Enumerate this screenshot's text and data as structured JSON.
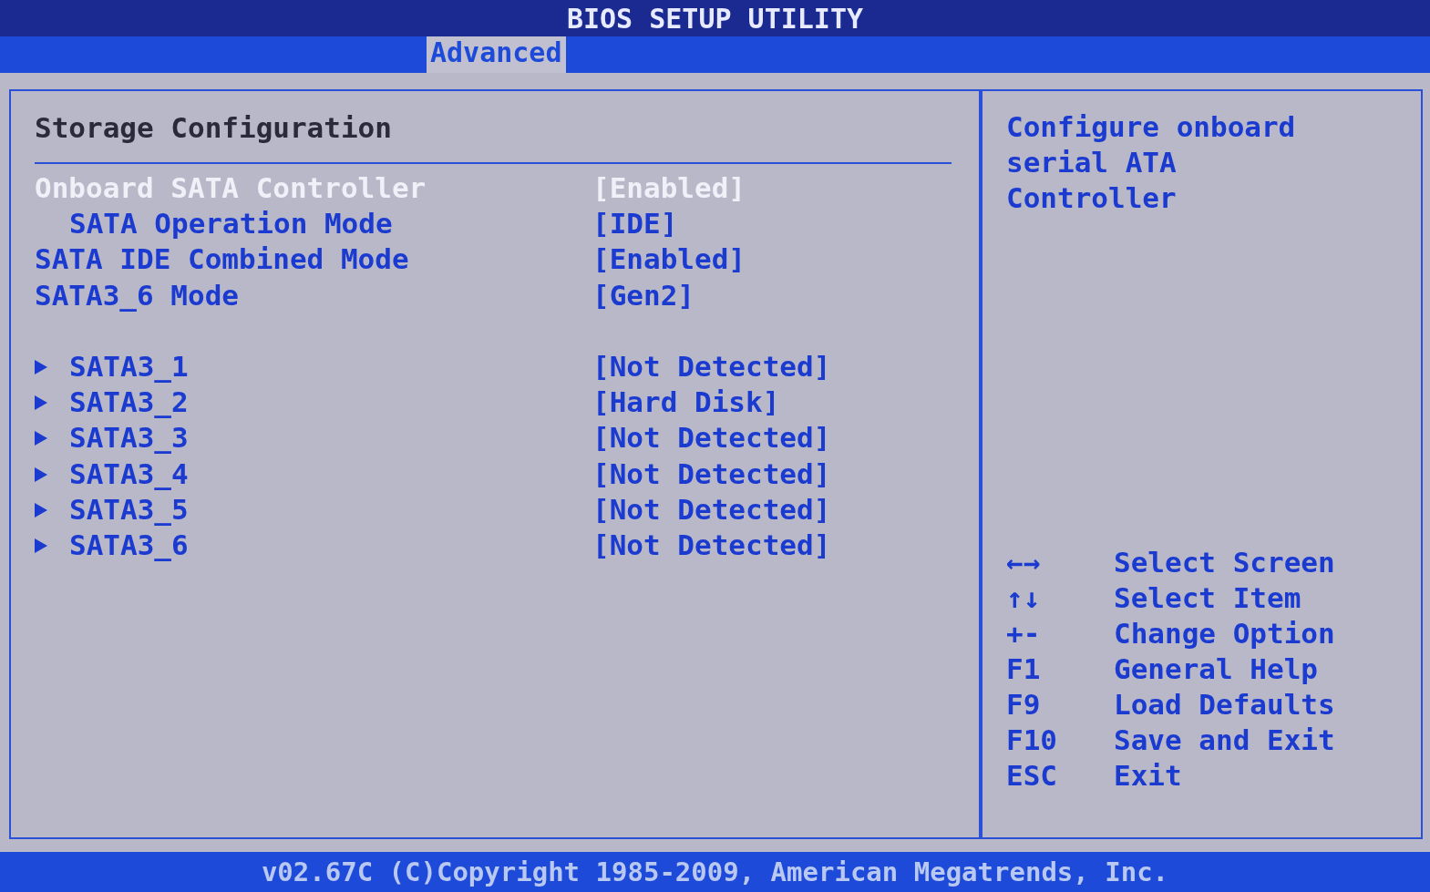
{
  "title": "BIOS SETUP UTILITY",
  "tabs": [
    {
      "label": "Advanced",
      "selected": true
    }
  ],
  "panel": {
    "title": "Storage Configuration",
    "settings": [
      {
        "label": "Onboard SATA Controller",
        "value": "[Enabled]",
        "selected": true,
        "children": [
          {
            "label": "SATA Operation Mode",
            "value": "[IDE]",
            "selected": false
          }
        ]
      },
      {
        "label": "SATA IDE Combined Mode",
        "value": "[Enabled]",
        "selected": false
      },
      {
        "label": "SATA3_6 Mode",
        "value": "[Gen2]",
        "selected": false
      }
    ],
    "devices": [
      {
        "label": "SATA3_1",
        "value": "[Not Detected]",
        "selected": false
      },
      {
        "label": "SATA3_2",
        "value": "[Hard Disk]",
        "selected": false
      },
      {
        "label": "SATA3_3",
        "value": "[Not Detected]",
        "selected": false
      },
      {
        "label": "SATA3_4",
        "value": "[Not Detected]",
        "selected": false
      },
      {
        "label": "SATA3_5",
        "value": "[Not Detected]",
        "selected": false
      },
      {
        "label": "SATA3_6",
        "value": "[Not Detected]",
        "selected": false
      }
    ]
  },
  "help": {
    "text": "Configure onboard serial ATA Controller",
    "keys": [
      {
        "key": "←→",
        "action": "Select Screen"
      },
      {
        "key": "↑↓",
        "action": "Select Item"
      },
      {
        "key": "+-",
        "action": "Change Option"
      },
      {
        "key": "F1",
        "action": "General Help"
      },
      {
        "key": "F9",
        "action": "Load Defaults"
      },
      {
        "key": "F10",
        "action": "Save and Exit"
      },
      {
        "key": "ESC",
        "action": "Exit"
      }
    ]
  },
  "footer": "v02.67C (C)Copyright 1985-2009, American Megatrends, Inc."
}
